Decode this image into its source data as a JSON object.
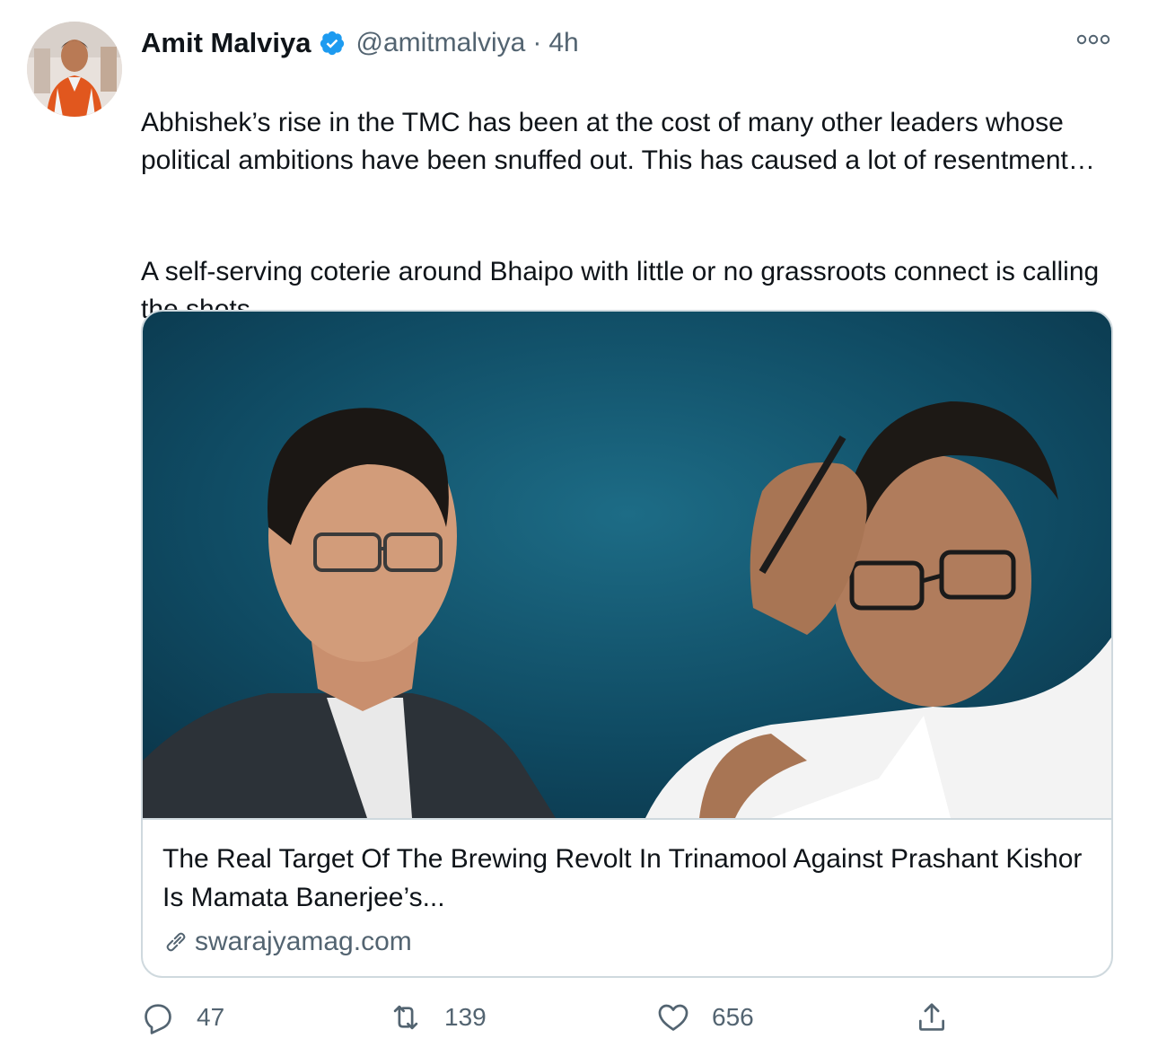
{
  "author": {
    "name": "Amit Malviya",
    "handle": "@amitmalviya",
    "separator": "·",
    "time": "4h",
    "avatar_icon": "profile-photo",
    "verified_icon": "verified-badge-icon",
    "verified_color": "#1d9bf0"
  },
  "tweet": {
    "paragraph1": "Abhishek’s rise in the TMC has been at the cost of many other leaders whose political ambitions have been snuffed out. This has caused a lot of resentment…",
    "paragraph2": "A self-serving coterie around Bhaipo with little or no grassroots connect is calling the shots."
  },
  "card": {
    "title": "The Real Target Of The Brewing Revolt In Trinamool Against Prashant Kishor Is Mamata Banerjee’s...",
    "domain": "swarajyamag.com",
    "image_background": "#0f4a62"
  },
  "actions": {
    "reply": {
      "icon": "reply-icon",
      "count": "47"
    },
    "retweet": {
      "icon": "retweet-icon",
      "count": "139"
    },
    "like": {
      "icon": "heart-icon",
      "count": "656"
    },
    "share": {
      "icon": "share-icon"
    }
  },
  "colors": {
    "text": "#0f1419",
    "secondary": "#536471",
    "border": "#cfd9de"
  }
}
